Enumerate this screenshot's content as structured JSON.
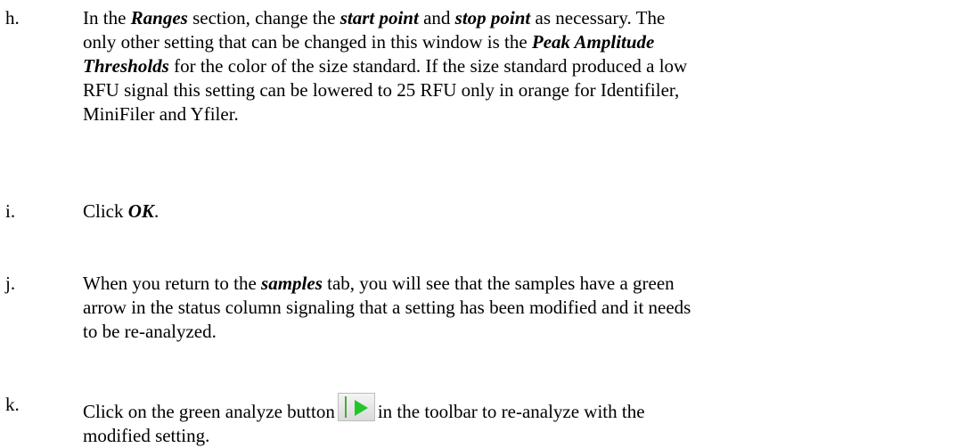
{
  "steps": [
    {
      "letter": "h.",
      "lines": [
        [
          "In the ",
          {
            "b": "Ranges"
          },
          " section, change the ",
          {
            "b": "start point"
          },
          " and ",
          {
            "b": "stop point"
          },
          " as necessary.  The"
        ],
        [
          "only other setting that can be changed in this window is the ",
          {
            "b": "Peak Amplitude"
          }
        ],
        [
          {
            "b": "Thresholds"
          },
          " for the color of the size standard.  If the size standard produced a low"
        ],
        [
          "RFU signal this setting can be lowered to 25 RFU only in orange for Identifiler,"
        ],
        [
          "MiniFiler and Yfiler."
        ]
      ]
    },
    {
      "letter": "i.",
      "lines": [
        [
          "Click ",
          {
            "b": "OK"
          },
          "."
        ]
      ]
    },
    {
      "letter": "j.",
      "lines": [
        [
          "When you return to the ",
          {
            "b": "samples"
          },
          " tab, you will see that the samples have a green"
        ],
        [
          "arrow in the status column signaling that a setting has been modified and it needs"
        ],
        [
          "to be re-analyzed."
        ]
      ]
    },
    {
      "letter": "k.",
      "lines": [
        [
          "Click on the green analyze button",
          {
            "icon": "analyze-button-icon"
          },
          "in the toolbar to re-analyze with the"
        ],
        [
          "modified setting."
        ]
      ]
    }
  ]
}
